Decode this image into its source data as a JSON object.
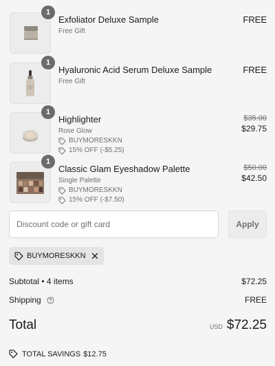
{
  "cart": {
    "items": [
      {
        "name": "Exfoliator Deluxe Sample",
        "variant": "Free Gift",
        "quantity": "1",
        "price": "FREE",
        "image_icon": "exfoliator-jar-icon"
      },
      {
        "name": "Hyaluronic Acid Serum Deluxe Sample",
        "variant": "Free Gift",
        "quantity": "1",
        "price": "FREE",
        "image_icon": "serum-dropper-bottle-icon"
      },
      {
        "name": "Highlighter",
        "variant": "Rose Glow",
        "quantity": "1",
        "original_price": "$35.00",
        "price": "$29.75",
        "discount_code": "BUYMORESKKN",
        "discount_amount": "15% OFF (-$5.25)",
        "image_icon": "highlighter-compact-icon"
      },
      {
        "name": "Classic Glam Eyeshadow Palette",
        "variant": "Single Palette",
        "quantity": "1",
        "original_price": "$50.00",
        "price": "$42.50",
        "discount_code": "BUYMORESKKN",
        "discount_amount": "15% OFF (-$7.50)",
        "image_icon": "eyeshadow-palette-icon"
      }
    ]
  },
  "discount_form": {
    "placeholder": "Discount code or gift card",
    "value": "",
    "apply_label": "Apply"
  },
  "applied_code": {
    "code": "BUYMORESKKN"
  },
  "summary": {
    "subtotal_label": "Subtotal • 4 items",
    "subtotal_value": "$72.25",
    "shipping_label": "Shipping",
    "shipping_value": "FREE",
    "total_label": "Total",
    "total_currency": "USD",
    "total_value": "$72.25",
    "savings_label": "TOTAL SAVINGS",
    "savings_value": "$12.75"
  },
  "colors": {
    "background": "#f5f5f5",
    "text_primary": "#1a1a1a",
    "text_secondary": "#707070",
    "badge": "#6b6b6b",
    "chip_background": "#e4e4e4"
  }
}
